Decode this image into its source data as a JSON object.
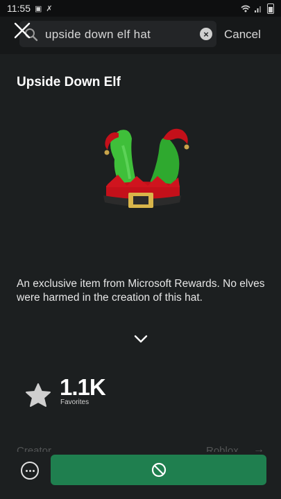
{
  "status": {
    "time": "11:55",
    "icons": [
      "notification-icon",
      "signal-muted-icon",
      "wifi-icon",
      "cell-signal-icon",
      "battery-icon"
    ]
  },
  "search": {
    "query": "upside down elf hat",
    "cancel_label": "Cancel"
  },
  "item": {
    "title": "Upside Down Elf",
    "description": "An exclusive item from Microsoft Rewards. No elves were harmed in the creation of this hat.",
    "favorites_count": "1.1K",
    "favorites_label": "Favorites",
    "creator_label": "Creator",
    "creator_name": "Roblox"
  },
  "colors": {
    "background": "#1c1f20",
    "buy_button": "#1f7f4f",
    "hat_green": "#3fbf3a",
    "hat_red": "#c4101a",
    "buckle_gold": "#d9b54a"
  },
  "actions": {
    "buy_icon": "unavailable-icon",
    "more_icon": "more-options-icon"
  }
}
